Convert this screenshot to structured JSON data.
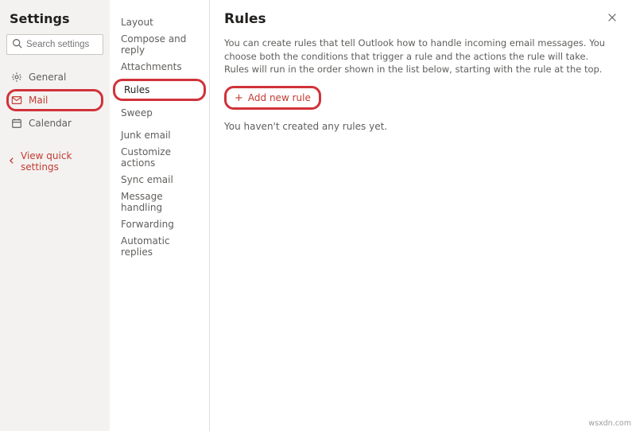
{
  "header": {
    "title": "Settings"
  },
  "search": {
    "placeholder": "Search settings"
  },
  "primary_nav": {
    "items": [
      {
        "label": "General",
        "active": false
      },
      {
        "label": "Mail",
        "active": true
      },
      {
        "label": "Calendar",
        "active": false
      }
    ],
    "quick_settings_label": "View quick settings"
  },
  "mail_subnav": {
    "items": [
      {
        "label": "Layout"
      },
      {
        "label": "Compose and reply"
      },
      {
        "label": "Attachments"
      },
      {
        "label": "Rules",
        "selected": true
      },
      {
        "label": "Sweep"
      },
      {
        "label": "Junk email"
      },
      {
        "label": "Customize actions"
      },
      {
        "label": "Sync email"
      },
      {
        "label": "Message handling"
      },
      {
        "label": "Forwarding"
      },
      {
        "label": "Automatic replies"
      }
    ]
  },
  "main": {
    "title": "Rules",
    "description": "You can create rules that tell Outlook how to handle incoming email messages. You choose both the conditions that trigger a rule and the actions the rule will take. Rules will run in the order shown in the list below, starting with the rule at the top.",
    "add_rule_label": "Add new rule",
    "empty_state": "You haven't created any rules yet."
  },
  "watermark": "wsxdn.com"
}
